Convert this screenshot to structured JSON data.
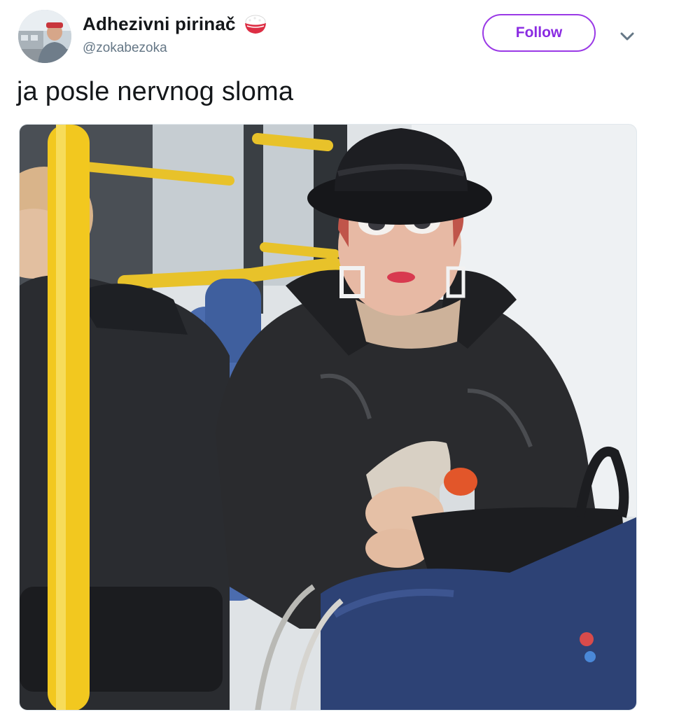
{
  "tweet": {
    "author": {
      "display_name": "Adhezivni pirinač",
      "emoji": "rice-bowl-emoji",
      "handle": "@zokabezoka",
      "avatar": "profile-photo"
    },
    "follow_label": "Follow",
    "menu_icon": "chevron-down-icon",
    "text": "ja posle nervnog sloma",
    "media": {
      "type": "photo"
    }
  },
  "colors": {
    "accent": "#8a2be2",
    "text_primary": "#14171a",
    "text_secondary": "#657786"
  }
}
